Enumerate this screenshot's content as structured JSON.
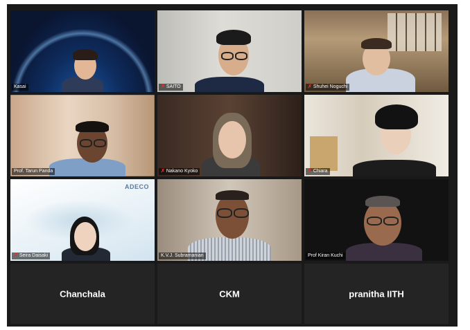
{
  "participants": [
    {
      "name": "Kasai",
      "muted": false
    },
    {
      "name": "SAITO",
      "muted": true
    },
    {
      "name": "Shuhei Noguchi",
      "muted": true
    },
    {
      "name": "Prof. Tarun Panda",
      "muted": false
    },
    {
      "name": "Nakano Kyoko",
      "muted": true
    },
    {
      "name": "Chiara",
      "muted": true
    },
    {
      "name": "Seira Daisaki",
      "muted": true
    },
    {
      "name": "K.V.J. Subramanian",
      "muted": false
    },
    {
      "name": "Prof Kiran Kuchi",
      "muted": false
    }
  ],
  "audio_only": [
    {
      "name": "Chanchala"
    },
    {
      "name": "CKM"
    },
    {
      "name": "pranitha IITH"
    }
  ],
  "logo_text": "ADECO",
  "mic_muted_icon": "mic-muted-icon",
  "colors": {
    "active_speaker_border": "#d8e06a",
    "muted_mic": "#e0312a"
  }
}
